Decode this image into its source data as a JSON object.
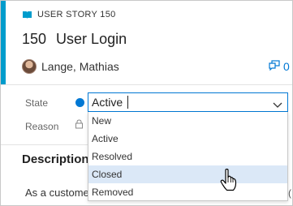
{
  "colors": {
    "accent": "#009ccc",
    "state_active": "#0078d4",
    "focus_border": "#0078d4",
    "hover_row": "#dbe8f7"
  },
  "work_item": {
    "type_label": "USER STORY 150",
    "type_icon": "book-icon",
    "id": "150",
    "title": "User Login",
    "assignee": "Lange, Mathias",
    "comments_count": "0",
    "comments_icon": "comment-icon"
  },
  "fields": {
    "state_label": "State",
    "state_value": "Active",
    "reason_label": "Reason"
  },
  "dropdown": {
    "options": [
      "New",
      "Active",
      "Resolved",
      "Closed",
      "Removed"
    ],
    "hovered": "Closed"
  },
  "description": {
    "title": "Description",
    "text": "As a custome",
    "trailing_glyph": "("
  }
}
